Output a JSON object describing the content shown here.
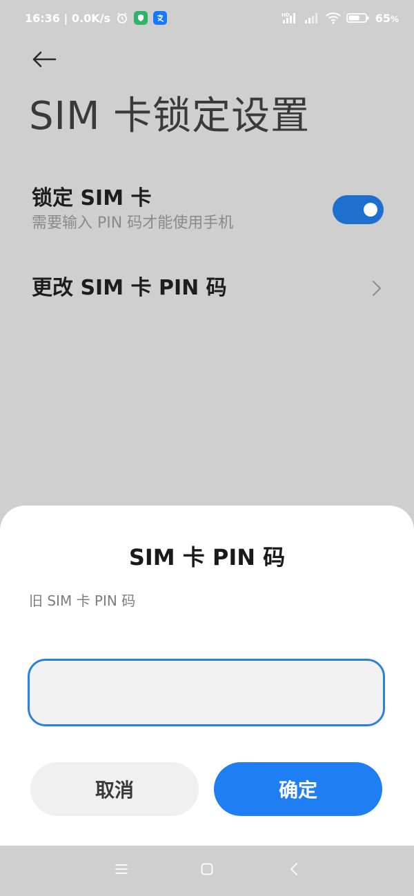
{
  "status_bar": {
    "time_speed": "16:36 | 0.0K/s",
    "battery": "65",
    "battery_unit": "%",
    "icons": [
      "alarm-icon",
      "shield-app-icon",
      "alipay-app-icon",
      "hd-signal-icon",
      "signal-icon",
      "wifi-icon",
      "battery-icon"
    ]
  },
  "header": {
    "back_icon": "back-arrow-icon",
    "title": "SIM 卡锁定设置"
  },
  "settings": {
    "lock_sim": {
      "title": "锁定 SIM 卡",
      "subtitle": "需要输入 PIN 码才能使用手机",
      "enabled": true
    },
    "change_pin": {
      "title": "更改 SIM 卡 PIN 码",
      "icon": "chevron-right-icon"
    }
  },
  "dialog": {
    "title": "SIM 卡 PIN 码",
    "field_label": "旧 SIM 卡 PIN 码",
    "input_value": "",
    "cancel_label": "取消",
    "confirm_label": "确定"
  },
  "nav_bar": {
    "icons": [
      "menu-icon",
      "home-icon",
      "back-icon"
    ]
  },
  "colors": {
    "accent": "#1f7ef2",
    "toggle": "#1f6fcf",
    "dim_background": "#cfcfcf",
    "sheet": "#ffffff"
  }
}
